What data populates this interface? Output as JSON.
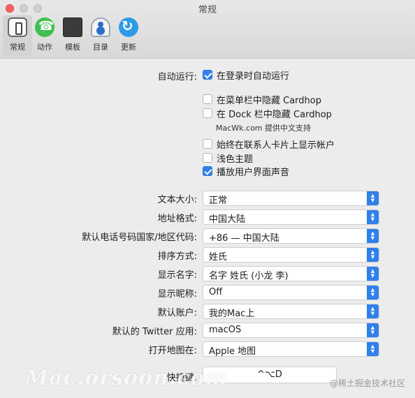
{
  "window": {
    "title": "常规"
  },
  "toolbar": {
    "tabs": [
      {
        "label": "常规",
        "icon": "general-icon",
        "selected": true
      },
      {
        "label": "动作",
        "icon": "phone-icon",
        "selected": false
      },
      {
        "label": "模板",
        "icon": "template-icon",
        "selected": false
      },
      {
        "label": "目录",
        "icon": "contacts-icon",
        "selected": false
      },
      {
        "label": "更新",
        "icon": "refresh-icon",
        "selected": false
      }
    ]
  },
  "general": {
    "autostart_label": "自动运行:",
    "autostart_option": "在登录时自动运行",
    "autostart_checked": true,
    "hide_menubar": "在菜单栏中隐藏 Cardhop",
    "hide_menubar_checked": false,
    "hide_dock": "在 Dock 栏中隐藏 Cardhop",
    "hide_dock_checked": false,
    "credit_note": "MacWk.com 提供中文支持",
    "show_account": "始终在联系人卡片上显示帐户",
    "show_account_checked": false,
    "light_theme": "浅色主题",
    "light_theme_checked": false,
    "ui_sounds": "播放用户界面声音",
    "ui_sounds_checked": true
  },
  "settings": [
    {
      "label": "文本大小:",
      "value": "正常"
    },
    {
      "label": "地址格式:",
      "value": "中国大陆"
    },
    {
      "label": "默认电话号码国家/地区代码:",
      "value": "+86 — 中国大陆"
    },
    {
      "label": "排序方式:",
      "value": "姓氏"
    },
    {
      "label": "显示名字:",
      "value": "名字 姓氏 (小龙 李)"
    },
    {
      "label": "显示昵称:",
      "value": "Off"
    },
    {
      "label": "默认账户:",
      "value": "我的Mac上"
    },
    {
      "label": "默认的 Twitter 应用:",
      "value": "macOS"
    },
    {
      "label": "打开地图在:",
      "value": "Apple 地图"
    }
  ],
  "shortcut": {
    "label": "快捷键:",
    "value": "^⌥D"
  },
  "overlay": {
    "watermark": "Mac.orsoon.com",
    "credit": "@稀土掘金技术社区"
  },
  "colors": {
    "accent": "#2f80ed",
    "close": "#fc605c"
  }
}
